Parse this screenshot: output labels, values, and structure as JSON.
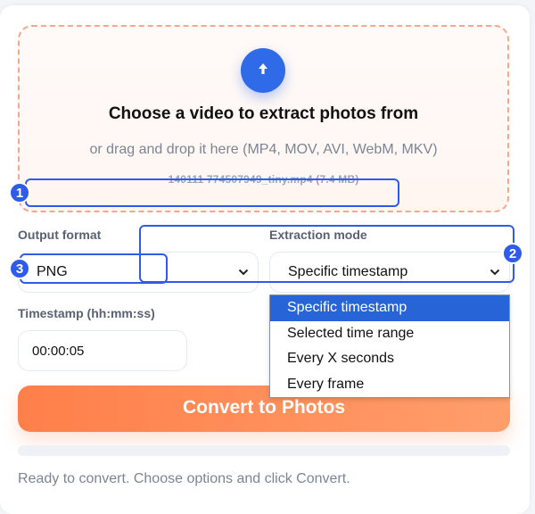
{
  "upload": {
    "title": "Choose a video to extract photos from",
    "subtitle": "or drag and drop it here (MP4, MOV, AVI, WebM, MKV)",
    "file_info": "140111 774507949_tiny.mp4 (7.4 MB)",
    "icon": "arrow-up-icon"
  },
  "output_format": {
    "label": "Output format",
    "value": "PNG"
  },
  "extraction_mode": {
    "label": "Extraction mode",
    "value": "Specific timestamp",
    "options": [
      "Specific timestamp",
      "Selected time range",
      "Every X seconds",
      "Every frame"
    ],
    "selected_index": 0
  },
  "timestamp": {
    "label": "Timestamp (hh:mm:ss)",
    "value": "00:00:05"
  },
  "convert_button": {
    "label": "Convert to Photos"
  },
  "progress": {
    "value": 0
  },
  "status": "Ready to convert. Choose options and click Convert.",
  "annotations": [
    "1",
    "2",
    "3"
  ],
  "colors": {
    "accent_orange": "#ff8a55",
    "selection_blue": "#2664d8",
    "annotation_blue": "#2f5bea",
    "upload_blue": "#2f6be8"
  }
}
